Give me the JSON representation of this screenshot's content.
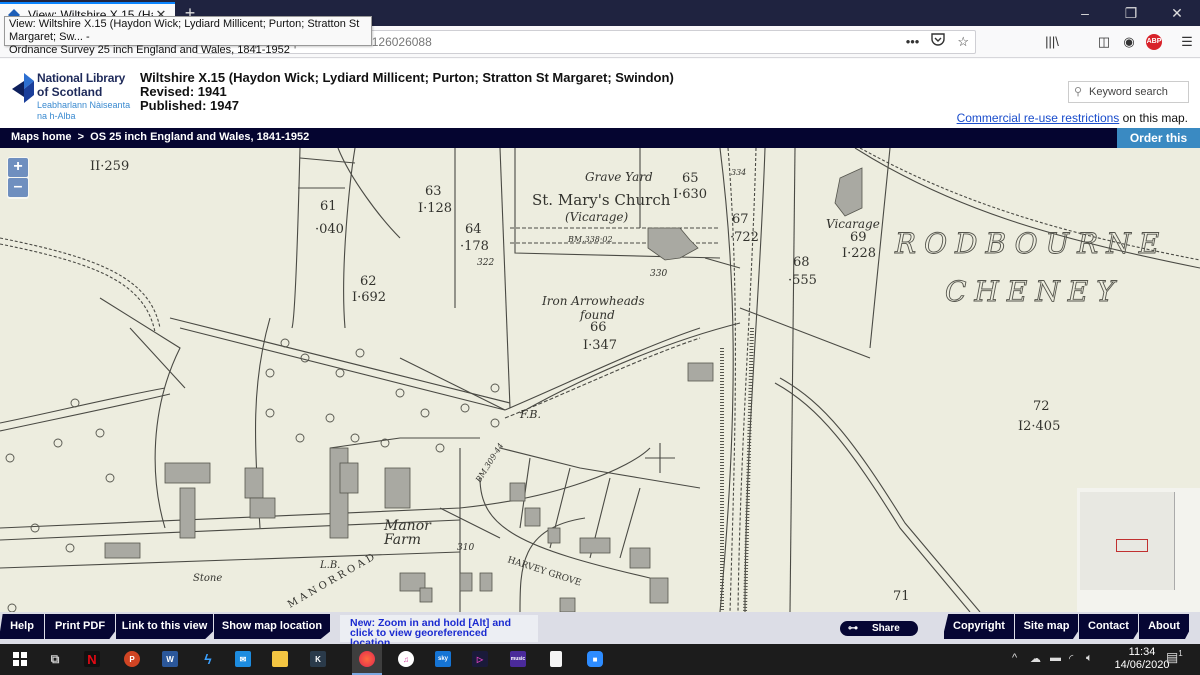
{
  "browser": {
    "tab_title": "View: Wiltshire X.15 (Haydon W...",
    "tab_close": "✕",
    "new_tab": "+",
    "tooltip_line1": "View: Wiltshire X.15 (Haydon Wick; Lydiard Millicent; Purton; Stratton St Margaret; Sw... -",
    "tooltip_line2": "Ordnance Survey 25 inch England and Wales, 1841-1952",
    "url_visible": "https://maps.nls.uk/view/126026088",
    "url_actions": [
      "•••",
      "pocket-icon",
      "bookmark-star-icon"
    ],
    "window_controls": {
      "minimize": "–",
      "restore": "❐",
      "close": "✕"
    },
    "toolbar_icons": [
      "library-icon",
      "sidebar-icon",
      "account-icon",
      "adblock-plus-icon",
      "menu-icon"
    ],
    "abp_label": "ABP"
  },
  "header": {
    "logo": {
      "line1": "National Library",
      "line2": "of Scotland",
      "line3": "Leabharlann Nàiseanta",
      "line4": "na h-Alba"
    },
    "title": "Wiltshire X.15 (Haydon Wick; Lydiard Millicent; Purton; Stratton St Margaret; Swindon)",
    "revised": "Revised: 1941",
    "published": "Published: 1947",
    "search_placeholder": "Keyword search",
    "reuse_link": "Commercial re-use restrictions",
    "reuse_suffix": " on this map."
  },
  "breadcrumb": {
    "text": "Maps home  >  OS 25 inch England and Wales, 1841-1952",
    "order_button": "Order this map"
  },
  "map": {
    "zoom_in": "+",
    "zoom_out": "–",
    "labels": [
      {
        "id": "p-ii259",
        "text": "II·259"
      },
      {
        "id": "p61",
        "text": "61"
      },
      {
        "id": "p61a",
        "text": "·040"
      },
      {
        "id": "p62",
        "text": "62"
      },
      {
        "id": "p62a",
        "text": "I·692"
      },
      {
        "id": "p63",
        "text": "63"
      },
      {
        "id": "p63a",
        "text": "I·128"
      },
      {
        "id": "p64",
        "text": "64"
      },
      {
        "id": "p64a",
        "text": "·178"
      },
      {
        "id": "h322",
        "text": "322"
      },
      {
        "id": "gy",
        "text": "Grave Yard"
      },
      {
        "id": "p65",
        "text": "65"
      },
      {
        "id": "p65a",
        "text": "I·630"
      },
      {
        "id": "church",
        "text": "St. Mary's Church"
      },
      {
        "id": "vic1",
        "text": "(Vicarage)"
      },
      {
        "id": "bm338",
        "text": "BM.338·02"
      },
      {
        "id": "h330",
        "text": "330"
      },
      {
        "id": "arrow",
        "text": "Iron Arrowheads"
      },
      {
        "id": "found",
        "text": "found"
      },
      {
        "id": "p66",
        "text": "66"
      },
      {
        "id": "p66a",
        "text": "I·347"
      },
      {
        "id": "h334",
        "text": "334"
      },
      {
        "id": "p67",
        "text": "67"
      },
      {
        "id": "p67a",
        "text": "·722"
      },
      {
        "id": "p68",
        "text": "68"
      },
      {
        "id": "p68a",
        "text": "·555"
      },
      {
        "id": "vic2",
        "text": "Vicarage"
      },
      {
        "id": "p69",
        "text": "69"
      },
      {
        "id": "p69a",
        "text": "I·228"
      },
      {
        "id": "rod",
        "text": "RODBOURNE"
      },
      {
        "id": "chen",
        "text": "CHENEY"
      },
      {
        "id": "p72",
        "text": "72"
      },
      {
        "id": "p72a",
        "text": "I2·405"
      },
      {
        "id": "fb",
        "text": "F.B."
      },
      {
        "id": "bm309",
        "text": "BM.309·44"
      },
      {
        "id": "manor",
        "text": "Manor"
      },
      {
        "id": "farm",
        "text": "Farm"
      },
      {
        "id": "h310",
        "text": "310"
      },
      {
        "id": "harvey",
        "text": "HARVEY GROVE"
      },
      {
        "id": "lb",
        "text": "L.B."
      },
      {
        "id": "stone",
        "text": "Stone"
      },
      {
        "id": "p71",
        "text": "71"
      },
      {
        "id": "road",
        "text": "M A N O R   R O A D"
      }
    ]
  },
  "footer": {
    "left_buttons": [
      "Help",
      "Print PDF",
      "Link to this view",
      "Show map location"
    ],
    "new_info": "New: Zoom in and hold [Alt] and click to view georeferenced location",
    "share": "Share",
    "right_buttons": [
      "Copyright",
      "Site map",
      "Contact",
      "About"
    ]
  },
  "taskbar": {
    "apps": [
      "windows-start",
      "task-view",
      "netflix",
      "powerpoint",
      "word",
      "app-s",
      "mail",
      "file-explorer",
      "kindle",
      "firefox",
      "itunes",
      "sky-go",
      "app-play",
      "amazon-music",
      "file",
      "zoom"
    ],
    "tray": [
      "^",
      "onedrive-icon",
      "network-card-icon",
      "wifi-icon",
      "volume-icon"
    ],
    "time": "11:34",
    "date": "14/06/2020",
    "notifications": "1"
  },
  "colors": {
    "nav_dark": "#060633",
    "order_blue": "#3a8ac2",
    "link_blue": "#1a4dcc",
    "map_paper": "#ededdf",
    "new_info_text": "#1a2ad0"
  }
}
